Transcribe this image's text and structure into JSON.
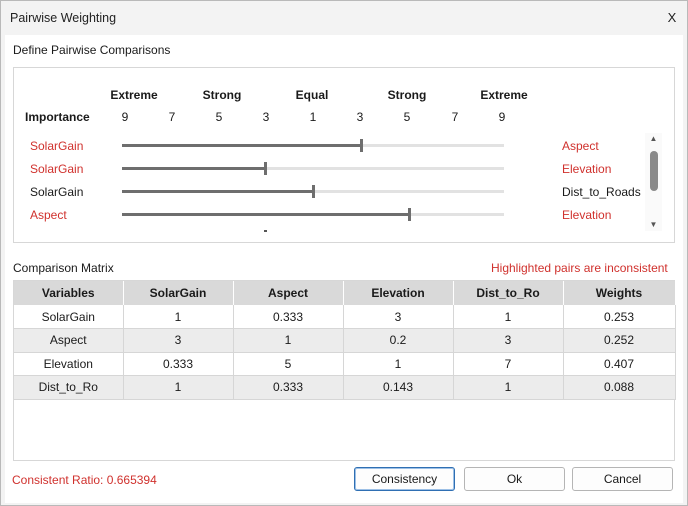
{
  "window": {
    "title": "Pairwise Weighting",
    "close_label": "X"
  },
  "define_section": {
    "title": "Define Pairwise Comparisons"
  },
  "scale": {
    "importance_label": "Importance",
    "labels": [
      "Extreme",
      "Strong",
      "Equal",
      "Strong",
      "Extreme"
    ],
    "numbers": [
      "9",
      "7",
      "5",
      "3",
      "1",
      "3",
      "5",
      "7",
      "9"
    ]
  },
  "comparisons": [
    {
      "left": "SolarGain",
      "right": "Aspect",
      "value": 0.625,
      "inconsistent": true
    },
    {
      "left": "SolarGain",
      "right": "Elevation",
      "value": 0.375,
      "inconsistent": true
    },
    {
      "left": "SolarGain",
      "right": "Dist_to_Roads",
      "value": 0.5,
      "inconsistent": false
    },
    {
      "left": "Aspect",
      "right": "Elevation",
      "value": 0.75,
      "inconsistent": true
    }
  ],
  "colors": {
    "inconsistent": "#d0312d",
    "normal": "#1a1a1a",
    "primary_border": "#2f6fb3"
  },
  "icons": {
    "scroll_up": "chevron-up-icon",
    "scroll_down": "chevron-down-icon"
  },
  "matrix_section": {
    "title": "Comparison Matrix",
    "inconsistent_note": "Highlighted pairs are inconsistent",
    "headers": [
      "Variables",
      "SolarGain",
      "Aspect",
      "Elevation",
      "Dist_to_Ro",
      "Weights"
    ],
    "rows": [
      [
        "SolarGain",
        "1",
        "0.333",
        "3",
        "1",
        "0.253"
      ],
      [
        "Aspect",
        "3",
        "1",
        "0.2",
        "3",
        "0.252"
      ],
      [
        "Elevation",
        "0.333",
        "5",
        "1",
        "7",
        "0.407"
      ],
      [
        "Dist_to_Ro",
        "1",
        "0.333",
        "0.143",
        "1",
        "0.088"
      ]
    ]
  },
  "footer": {
    "ratio_text": "Consistent Ratio: 0.665394",
    "consistency_label": "Consistency",
    "ok_label": "Ok",
    "cancel_label": "Cancel"
  }
}
